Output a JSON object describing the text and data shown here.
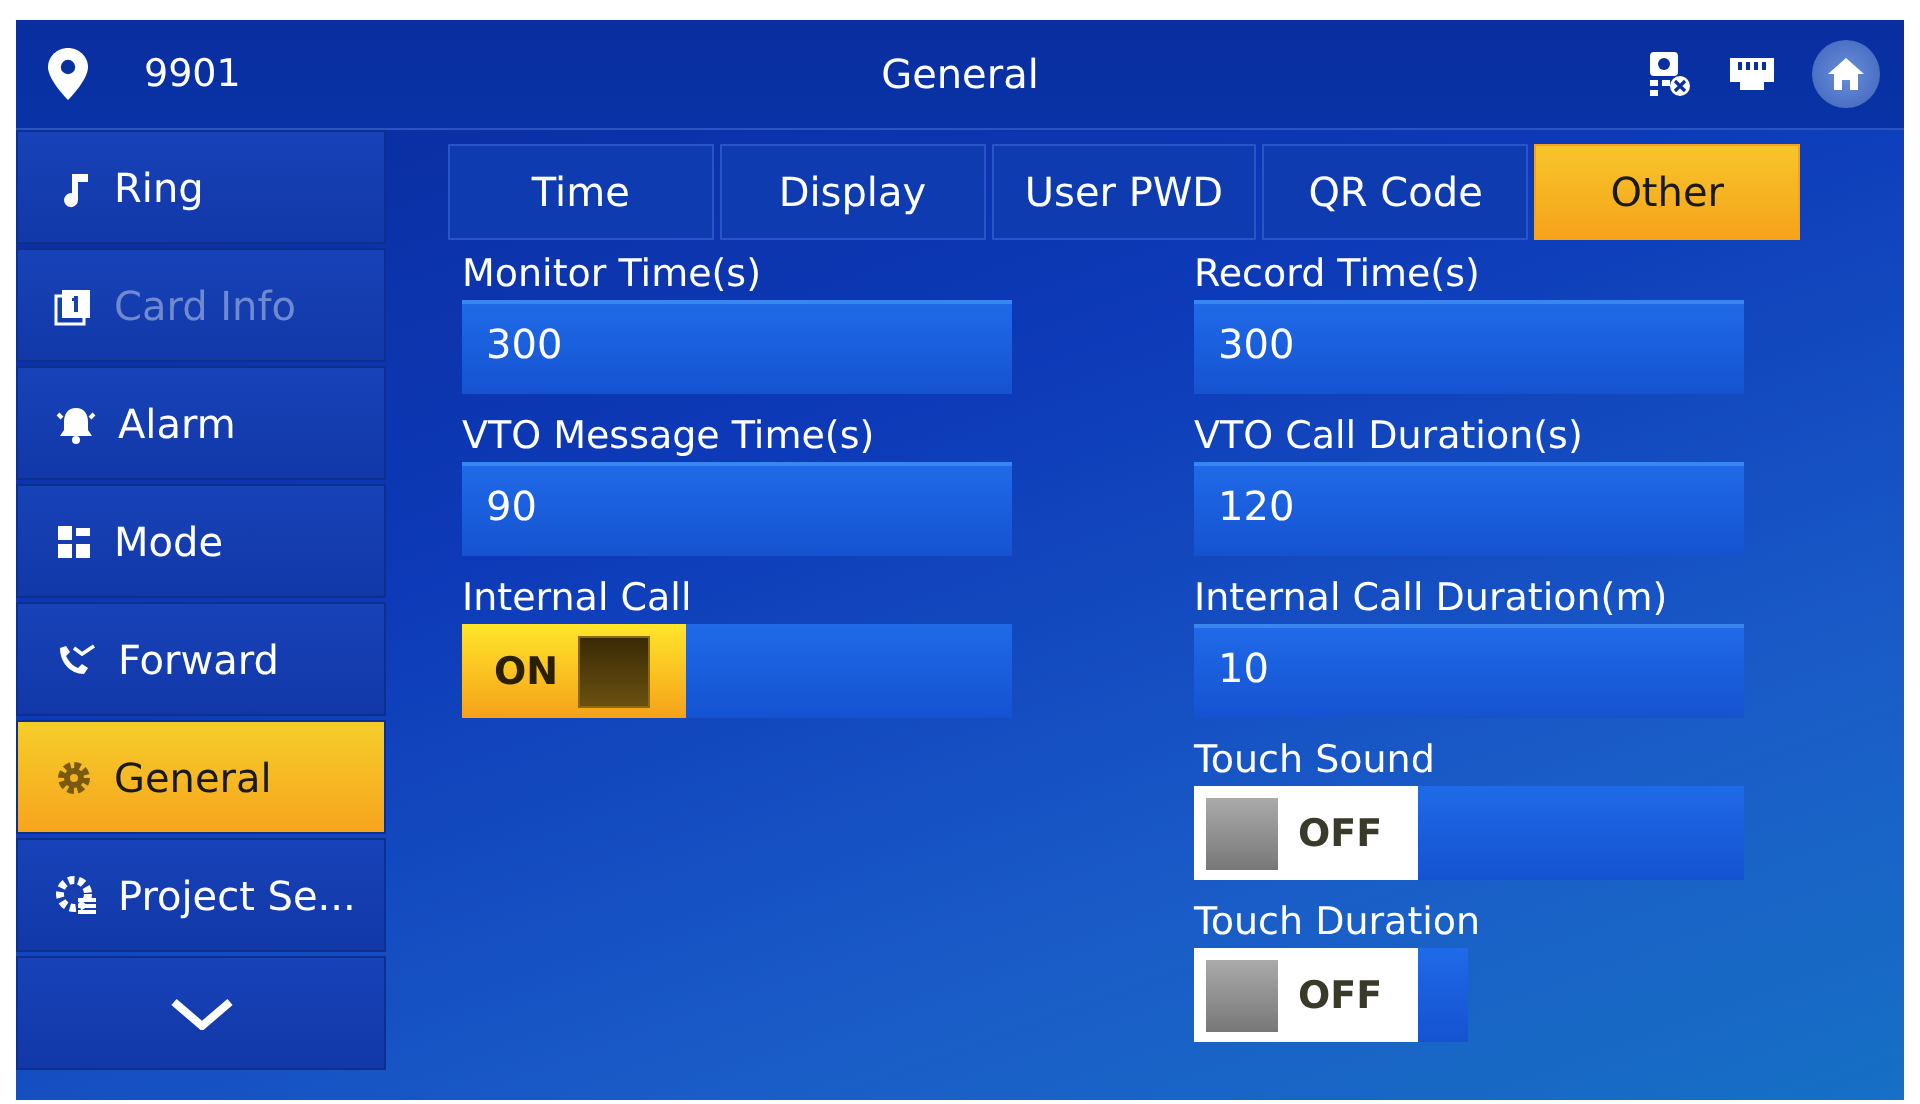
{
  "header": {
    "room": "9901",
    "title": "General"
  },
  "sidebar": {
    "items": [
      {
        "kind": "note",
        "label": "Ring",
        "selected": false,
        "disabled": false
      },
      {
        "kind": "card",
        "label": "Card Info",
        "selected": false,
        "disabled": true
      },
      {
        "kind": "bell",
        "label": "Alarm",
        "selected": false,
        "disabled": false
      },
      {
        "kind": "grid",
        "label": "Mode",
        "selected": false,
        "disabled": false
      },
      {
        "kind": "phone",
        "label": "Forward",
        "selected": false,
        "disabled": false
      },
      {
        "kind": "gear",
        "label": "General",
        "selected": true,
        "disabled": false
      },
      {
        "kind": "project",
        "label": "Project Se...",
        "selected": false,
        "disabled": false
      }
    ]
  },
  "tabs": [
    {
      "label": "Time",
      "selected": false
    },
    {
      "label": "Display",
      "selected": false
    },
    {
      "label": "User PWD",
      "selected": false
    },
    {
      "label": "QR Code",
      "selected": false
    },
    {
      "label": "Other",
      "selected": true
    }
  ],
  "left_fields": [
    {
      "kind": "text",
      "label": "Monitor Time(s)",
      "value": "300"
    },
    {
      "kind": "text",
      "label": "VTO Message Time(s)",
      "value": "90"
    },
    {
      "kind": "switch",
      "label": "Internal Call",
      "on": true,
      "value": "ON"
    }
  ],
  "right_fields": [
    {
      "kind": "text",
      "label": "Record Time(s)",
      "value": "300"
    },
    {
      "kind": "text",
      "label": "VTO Call Duration(s)",
      "value": "120"
    },
    {
      "kind": "text",
      "label": "Internal Call Duration(m)",
      "value": "10"
    },
    {
      "kind": "switch",
      "label": "Touch Sound",
      "on": false,
      "value": "OFF"
    },
    {
      "kind": "switch-compact",
      "label": "Touch Duration",
      "on": false,
      "value": "OFF"
    }
  ]
}
